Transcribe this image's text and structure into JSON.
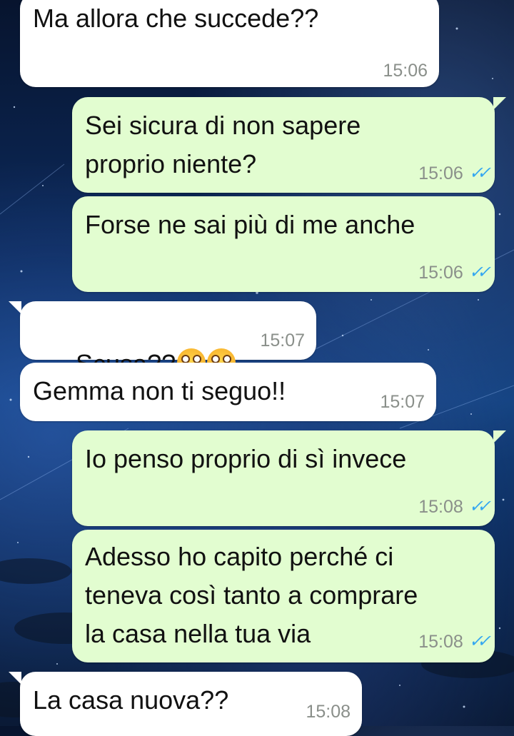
{
  "messages": [
    {
      "dir": "in",
      "lines": [
        "Ma allora che succede??"
      ],
      "time": "15:06"
    },
    {
      "dir": "out",
      "lines": [
        "Sei sicura di non sapere",
        "proprio niente?"
      ],
      "time": "15:06",
      "read": true
    },
    {
      "dir": "out",
      "lines": [
        "Forse ne sai più di me anche"
      ],
      "time": "15:06",
      "read": true
    },
    {
      "dir": "in",
      "lines": [
        "Scusa??"
      ],
      "emojis": [
        "flushed-face-emoji",
        "flushed-face-emoji"
      ],
      "time": "15:07"
    },
    {
      "dir": "in",
      "lines": [
        "Gemma non ti seguo!!"
      ],
      "time": "15:07"
    },
    {
      "dir": "out",
      "lines": [
        "Io penso proprio di sì invece"
      ],
      "time": "15:08",
      "read": true
    },
    {
      "dir": "out",
      "lines": [
        "Adesso ho capito perché ci",
        "teneva così tanto a comprare",
        "la casa nella tua via"
      ],
      "time": "15:08",
      "read": true
    },
    {
      "dir": "in",
      "lines": [
        "La casa nuova??"
      ],
      "time": "15:08"
    }
  ],
  "colors": {
    "incoming": "#ffffff",
    "outgoing": "#e2fdd0",
    "read_ticks": "#35a7f0",
    "timestamp": "#8a8f8a"
  }
}
